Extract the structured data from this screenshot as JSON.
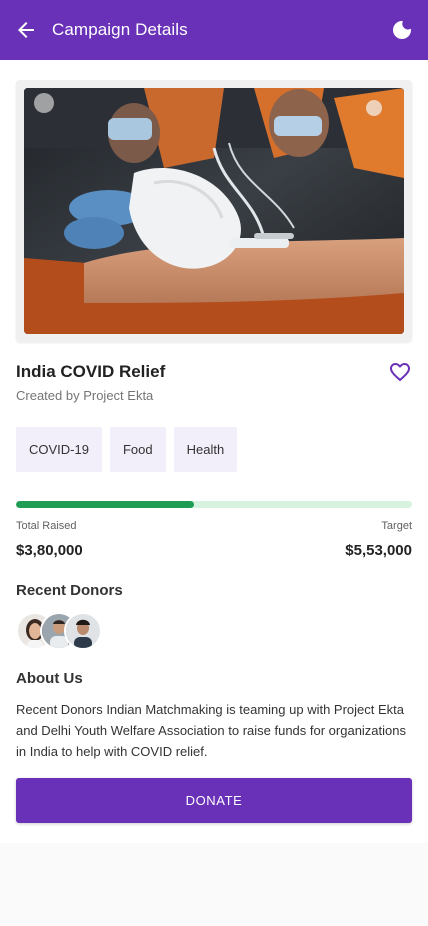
{
  "header": {
    "title": "Campaign Details",
    "back_icon": "arrow-left-icon",
    "theme_icon": "moon-icon",
    "color": "#6930b8"
  },
  "campaign": {
    "title": "India COVID Relief",
    "creator": "Created by Project Ekta",
    "favorite_icon": "heart-outline-icon",
    "tags": [
      "COVID-19",
      "Food",
      "Health"
    ],
    "progress": {
      "fraction": 0.45,
      "raised_label": "Total Raised",
      "raised_value": "$3,80,000",
      "target_label": "Target",
      "target_value": "$5,53,000",
      "fill_color": "#1f9d55",
      "track_color": "#d7f3df"
    },
    "recent_donors": {
      "heading": "Recent Donors",
      "count": 3
    },
    "about": {
      "heading": "About Us",
      "text": "Recent Donors Indian Matchmaking is teaming up with Project Ekta and Delhi Youth Welfare Association to raise funds for organizations in India to help with COVID relief."
    },
    "donate_label": "DONATE"
  }
}
